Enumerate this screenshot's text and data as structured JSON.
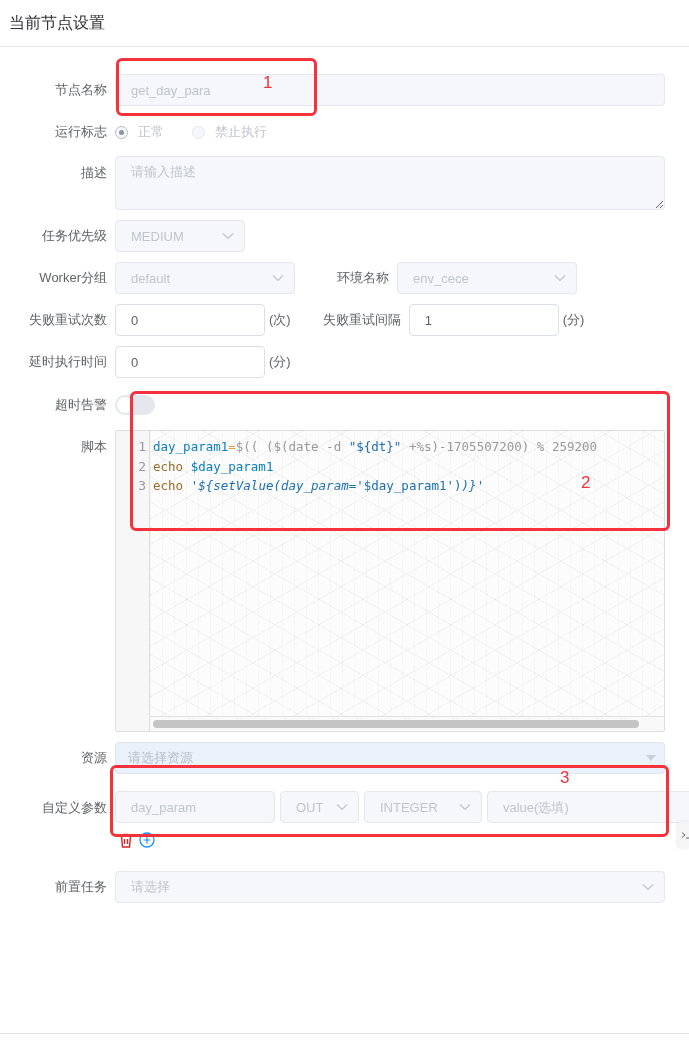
{
  "panel": {
    "title": "当前节点设置"
  },
  "form": {
    "node_name": {
      "label": "节点名称",
      "value": "get_day_para",
      "disabled": true
    },
    "run_flag": {
      "label": "运行标志",
      "disabled": true,
      "options": [
        {
          "label": "正常",
          "selected": true
        },
        {
          "label": "禁止执行",
          "selected": false
        }
      ]
    },
    "description": {
      "label": "描述",
      "placeholder": "请输入描述",
      "disabled": true
    },
    "priority": {
      "label": "任务优先级",
      "value": "MEDIUM",
      "disabled": true
    },
    "worker_group": {
      "label": "Worker分组",
      "value": "default",
      "disabled": true
    },
    "environment": {
      "label": "环境名称",
      "value": "env_cece",
      "disabled": true
    },
    "retry_times": {
      "label": "失败重试次数",
      "value": "0",
      "unit": "(次)",
      "disabled": false
    },
    "retry_interval": {
      "label": "失败重试间隔",
      "value": "1",
      "unit": "(分)",
      "disabled": false
    },
    "delay_time": {
      "label": "延时执行时间",
      "value": "0",
      "unit": "(分)",
      "disabled": false
    },
    "timeout_alarm": {
      "label": "超时告警",
      "on": false
    },
    "script": {
      "label": "脚本",
      "lines": [
        {
          "number": "1",
          "tokens": [
            {
              "kind": "var",
              "text": "day_param1"
            },
            {
              "kind": "op",
              "text": "="
            },
            {
              "kind": "plain",
              "text": "$(( ($(date -d "
            },
            {
              "kind": "str",
              "text": "\"${dt}\""
            },
            {
              "kind": "plain",
              "text": " +%s)-1705507200) % 259200"
            }
          ]
        },
        {
          "number": "2",
          "tokens": [
            {
              "kind": "kw",
              "text": "echo "
            },
            {
              "kind": "var",
              "text": "$day_param1"
            }
          ]
        },
        {
          "number": "3",
          "tokens": [
            {
              "kind": "kw",
              "text": "echo "
            },
            {
              "kind": "str",
              "text": "'"
            },
            {
              "kind": "tpl",
              "text": "${setValue(day_param"
            },
            {
              "kind": "str",
              "text": "='$day_param1')"
            },
            {
              "kind": "tpl",
              "text": ")}"
            },
            {
              "kind": "str",
              "text": "'"
            }
          ]
        }
      ]
    },
    "resources": {
      "label": "资源",
      "placeholder": "请选择资源"
    },
    "custom_params": {
      "label": "自定义参数",
      "rows": [
        {
          "name": "day_param",
          "direction": "OUT",
          "type": "INTEGER",
          "value_placeholder": "value(选填)",
          "disabled": true
        }
      ]
    },
    "pre_tasks": {
      "label": "前置任务",
      "placeholder": "请选择"
    }
  },
  "annotations": [
    {
      "label": "1"
    },
    {
      "label": "2"
    },
    {
      "label": "3"
    }
  ]
}
